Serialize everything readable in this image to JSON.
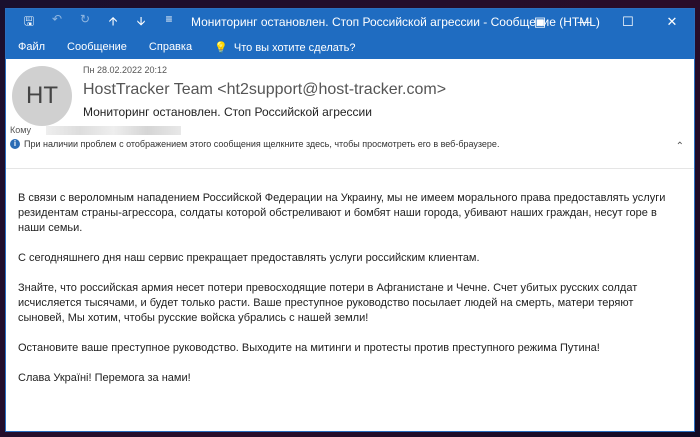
{
  "window": {
    "title": "Мониторинг остановлен. Стоп Российской агрессии  -  Сообщение (HTML)"
  },
  "menu": [
    "Файл",
    "Сообщение",
    "Справка"
  ],
  "tell_me": "Что вы хотите сделать?",
  "message": {
    "avatar_initials": "HT",
    "date": "Пн 28.02.2022 20:12",
    "from": "HostTracker Team <ht2support@host-tracker.com>",
    "subject": "Мониторинг остановлен. Стоп Российской агрессии",
    "to_label": "Кому",
    "info_bar": "При наличии проблем с отображением этого сообщения щелкните здесь, чтобы просмотреть его в веб-браузере.",
    "paragraphs": [
      "В связи с вероломным нападением Российской Федерации на Украину, мы не имеем морального права предоставлять услуги резидентам страны-агрессора, солдаты которой обстреливают и бомбят наши города, убивают наших граждан, несут горе в наши семьи.",
      "С сегодняшнего дня наш сервис прекращает предоставлять услуги российским клиентам.",
      "Знайте, что российская армия несет потери превосходящие потери в Афганистане и Чечне. Счет убитых русских солдат исчисляется тысячами, и будет только расти. Ваше преступное руководство посылает людей на смерть, матери теряют сыновей, Мы хотим, чтобы русские войска убрались с нашей земли!",
      "Остановите ваше преступное руководство. Выходите на митинги и протесты против преступного режима Путина!",
      "Слава Україні! Перемога за нами!"
    ]
  }
}
